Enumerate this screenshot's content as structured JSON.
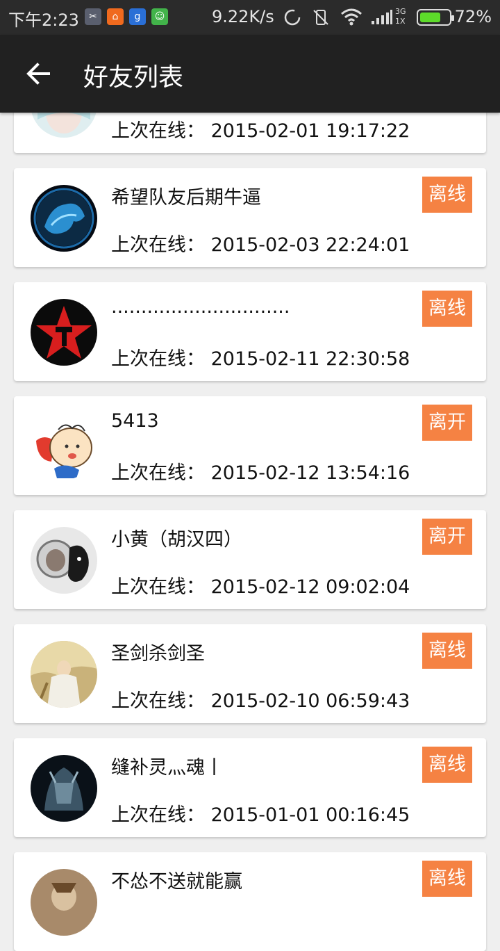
{
  "status_bar": {
    "time": "下午2:23",
    "net_speed": "9.22K/s",
    "network_type": "3G",
    "sim_slot": "1X",
    "battery_percent": "72%",
    "battery_level": 0.72,
    "icons": [
      "app-icon-gray",
      "app-icon-orange",
      "app-icon-blue",
      "app-icon-green",
      "sync-icon",
      "vibrate-off-icon",
      "wifi-icon",
      "signal-icon",
      "battery-icon"
    ]
  },
  "toolbar": {
    "title": "好友列表",
    "back_icon": "back-arrow-icon"
  },
  "colors": {
    "toolbar_bg": "#212121",
    "status_bar_bg": "#2b2b2b",
    "badge_bg": "#f58243",
    "page_bg": "#efefef",
    "card_bg": "#ffffff"
  },
  "last_seen_label": "上次在线：",
  "friends": [
    {
      "name": "",
      "last_seen": "2015-02-01 19:17:22",
      "status": "",
      "avatar": "girl-avatar"
    },
    {
      "name": "希望队友后期牛逼",
      "last_seen": "2015-02-03 22:24:01",
      "status": "离线",
      "avatar": "blue-frog-avatar"
    },
    {
      "name": "..............................",
      "last_seen": "2015-02-11 22:30:58",
      "status": "离线",
      "avatar": "red-star-avatar"
    },
    {
      "name": "5413",
      "last_seen": "2015-02-12 13:54:16",
      "status": "离开",
      "avatar": "cartoon-boy-avatar"
    },
    {
      "name": "小黄（胡汉四）",
      "last_seen": "2015-02-12 09:02:04",
      "status": "离开",
      "avatar": "astronaut-cat-avatar"
    },
    {
      "name": "圣剑杀剑圣",
      "last_seen": "2015-02-10 06:59:43",
      "status": "离线",
      "avatar": "warrior-avatar"
    },
    {
      "name": "缝补灵灬魂丨",
      "last_seen": "2015-01-01 00:16:45",
      "status": "离线",
      "avatar": "dark-knight-avatar"
    },
    {
      "name": "不怂不送就能赢",
      "last_seen": "",
      "status": "离线",
      "avatar": "warrior-avatar-2"
    }
  ]
}
